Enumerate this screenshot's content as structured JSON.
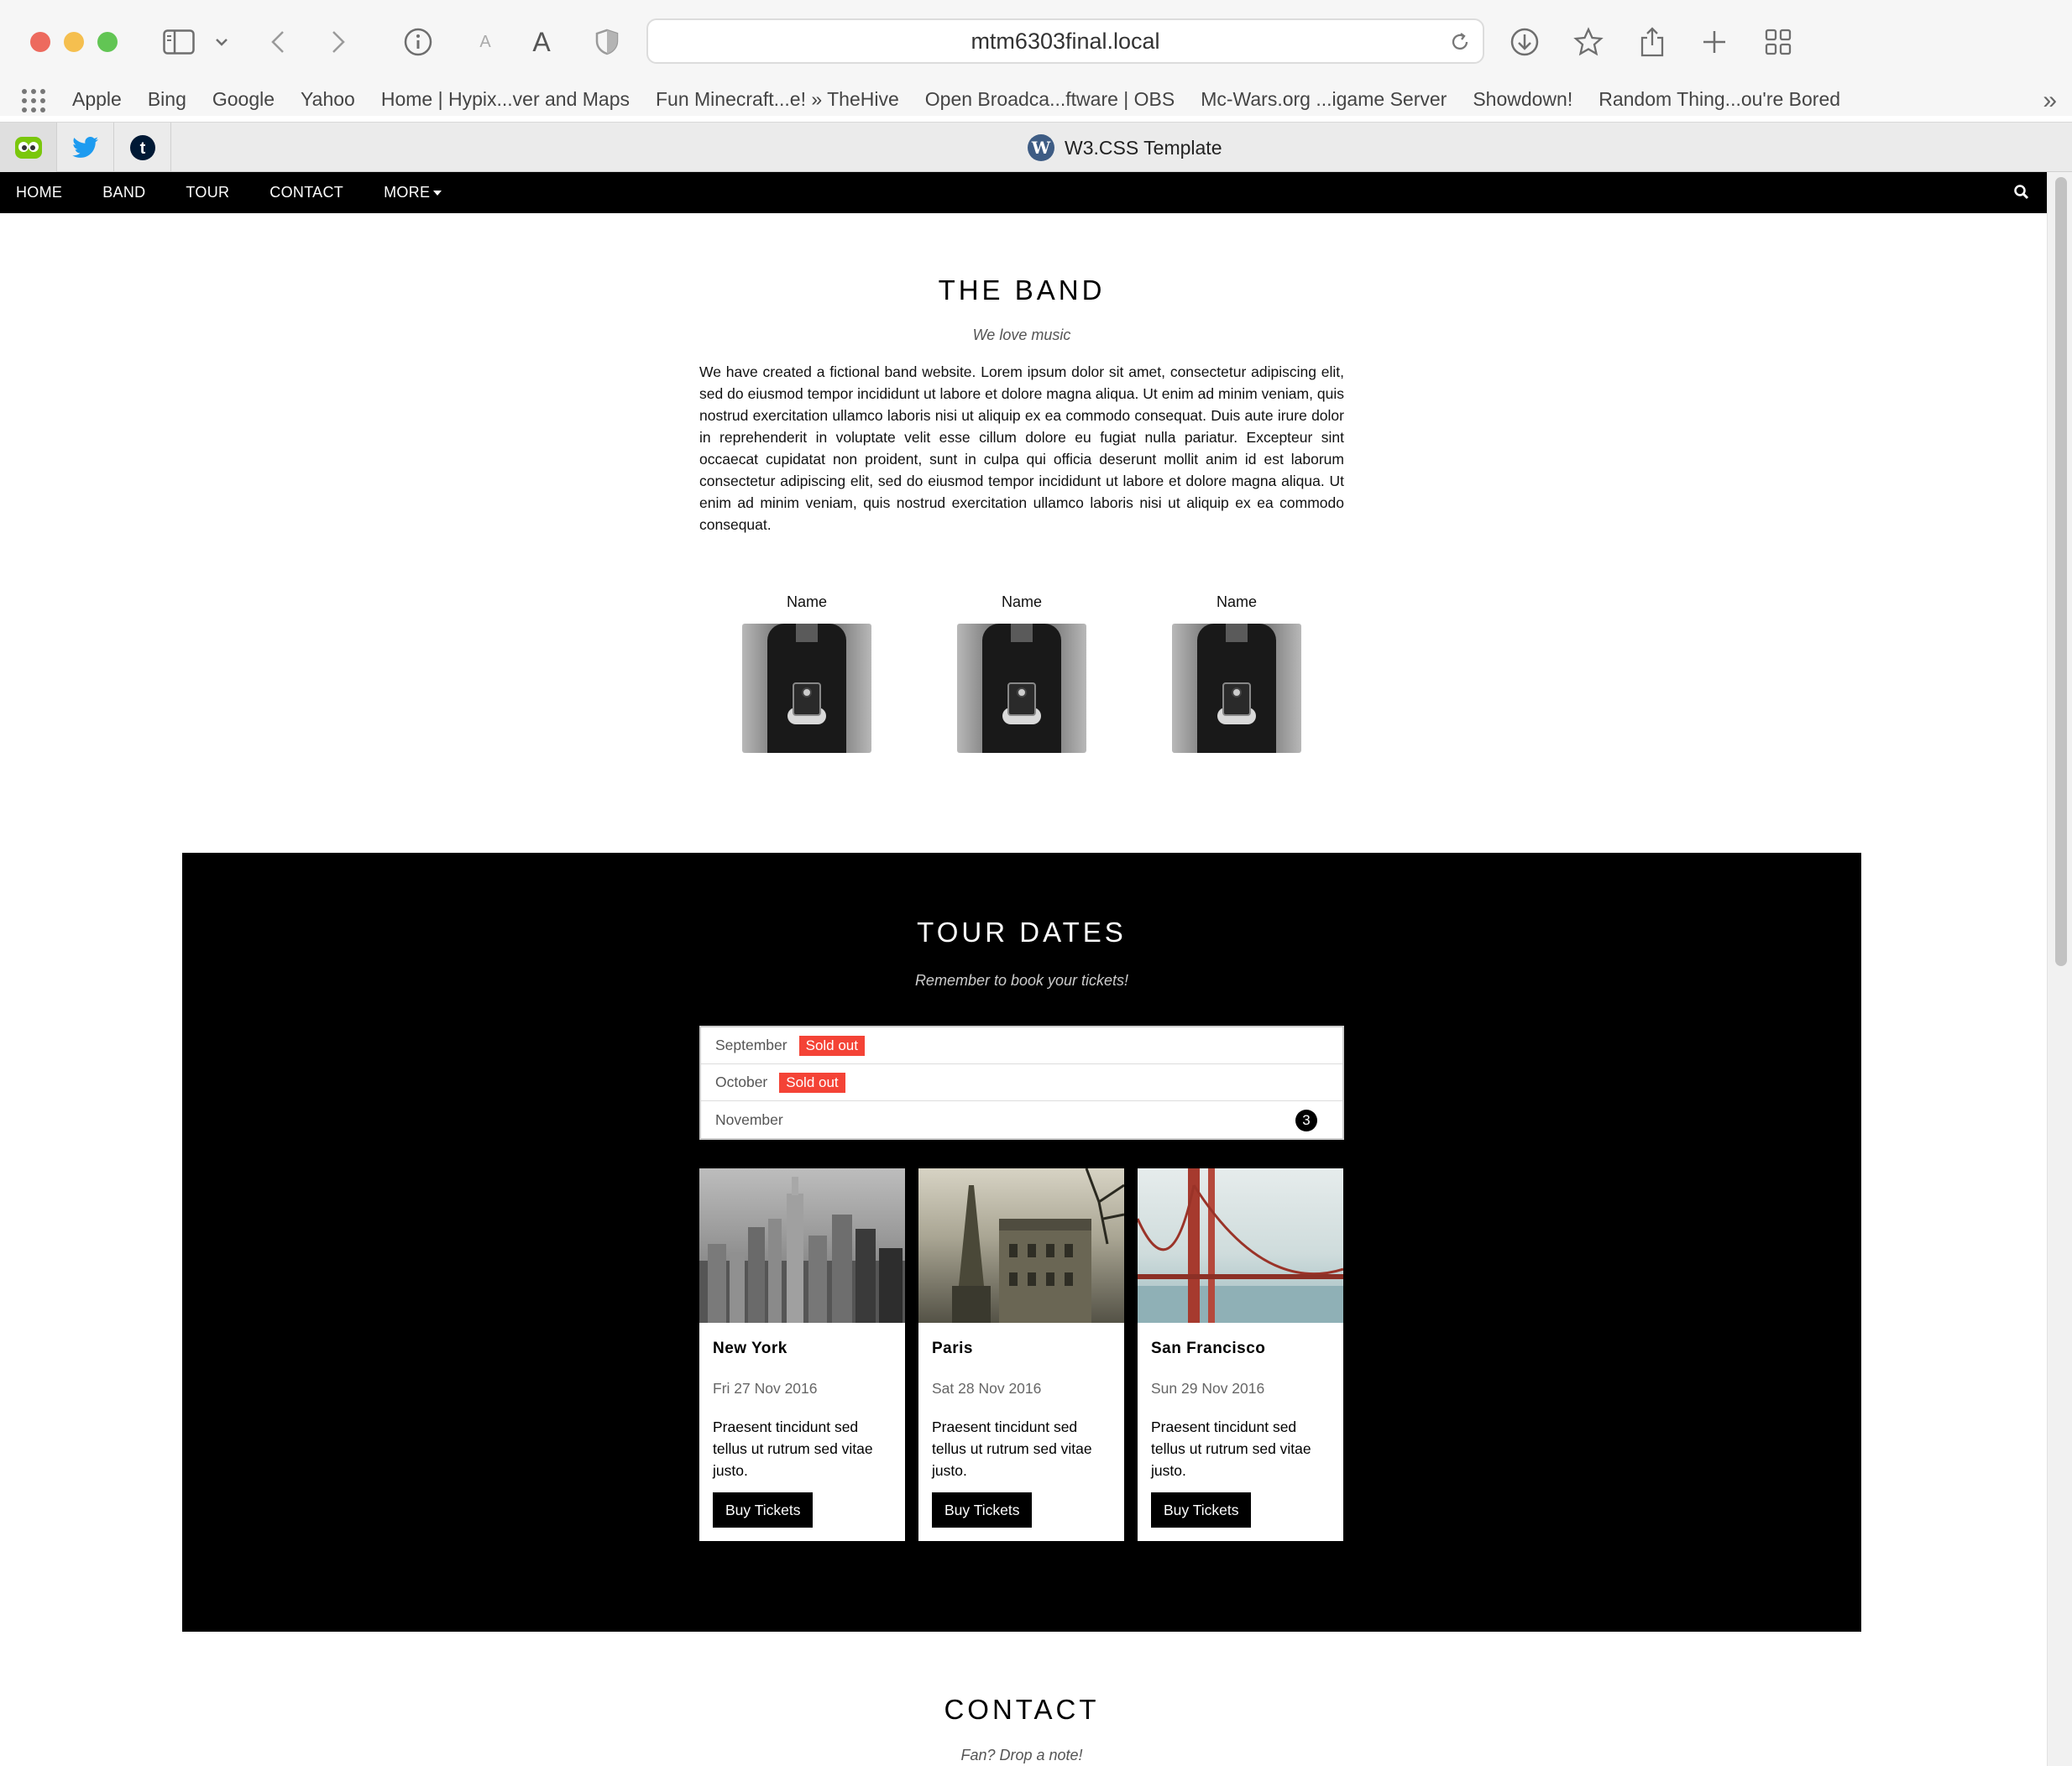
{
  "browser": {
    "url": "mtm6303final.local",
    "tab_title": "W3.CSS Template",
    "bookmarks": [
      "Apple",
      "Bing",
      "Google",
      "Yahoo",
      "Home | Hypix...ver and Maps",
      "Fun Minecraft...e! » TheHive",
      "Open Broadca...ftware | OBS",
      "Mc-Wars.org ...igame Server",
      "Showdown!",
      "Random Thing...ou're Bored"
    ],
    "bookmarks_more": "»",
    "pinned_tabs": [
      "duolingo-icon",
      "twitter-icon",
      "tumblr-icon"
    ]
  },
  "nav": {
    "items": [
      "HOME",
      "BAND",
      "TOUR",
      "CONTACT",
      "MORE"
    ]
  },
  "band": {
    "title": "THE BAND",
    "subtitle": "We love music",
    "text": "We have created a fictional band website. Lorem ipsum dolor sit amet, consectetur adipiscing elit, sed do eiusmod tempor incididunt ut labore et dolore magna aliqua. Ut enim ad minim veniam, quis nostrud exercitation ullamco laboris nisi ut aliquip ex ea commodo consequat. Duis aute irure dolor in reprehenderit in voluptate velit esse cillum dolore eu fugiat nulla pariatur. Excepteur sint occaecat cupidatat non proident, sunt in culpa qui officia deserunt mollit anim id est laborum consectetur adipiscing elit, sed do eiusmod tempor incididunt ut labore et dolore magna aliqua. Ut enim ad minim veniam, quis nostrud exercitation ullamco laboris nisi ut aliquip ex ea commodo consequat.",
    "members": [
      "Name",
      "Name",
      "Name"
    ]
  },
  "tour": {
    "title": "TOUR DATES",
    "subtitle": "Remember to book your tickets!",
    "months": [
      {
        "name": "September",
        "badge": "Sold out"
      },
      {
        "name": "October",
        "badge": "Sold out"
      },
      {
        "name": "November",
        "count": "3"
      }
    ],
    "cards": [
      {
        "city": "New York",
        "date": "Fri 27 Nov 2016",
        "desc": "Praesent tincidunt sed tellus ut rutrum sed vitae justo.",
        "button": "Buy Tickets"
      },
      {
        "city": "Paris",
        "date": "Sat 28 Nov 2016",
        "desc": "Praesent tincidunt sed tellus ut rutrum sed vitae justo.",
        "button": "Buy Tickets"
      },
      {
        "city": "San Francisco",
        "date": "Sun 29 Nov 2016",
        "desc": "Praesent tincidunt sed tellus ut rutrum sed vitae justo.",
        "button": "Buy Tickets"
      }
    ]
  },
  "contact": {
    "title": "CONTACT",
    "subtitle": "Fan? Drop a note!"
  }
}
